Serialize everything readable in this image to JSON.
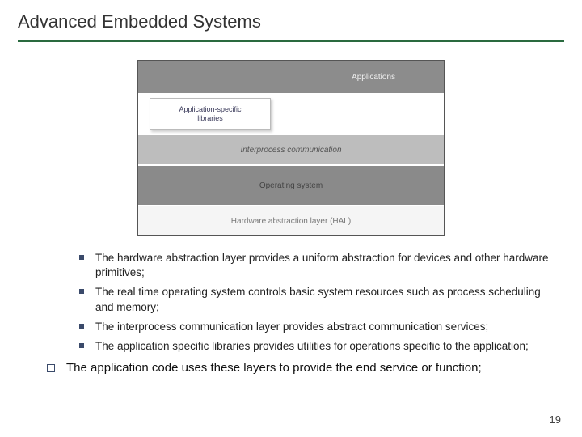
{
  "title": "Advanced Embedded Systems",
  "diagram": {
    "applications": "Applications",
    "libs_line1": "Application-specific",
    "libs_line2": "libraries",
    "ipc": "Interprocess communication",
    "os": "Operating system",
    "hal": "Hardware abstraction layer (HAL)"
  },
  "bullets": [
    "The hardware abstraction layer provides a uniform abstraction for devices and other hardware primitives;",
    "The real time operating system controls basic system resources such as process scheduling and memory;",
    "The interprocess communication layer provides abstract communication services;",
    "The application specific libraries provides utilities for operations specific to the application;"
  ],
  "summary": "The application code uses these layers to provide the end service or function;",
  "page": "19"
}
